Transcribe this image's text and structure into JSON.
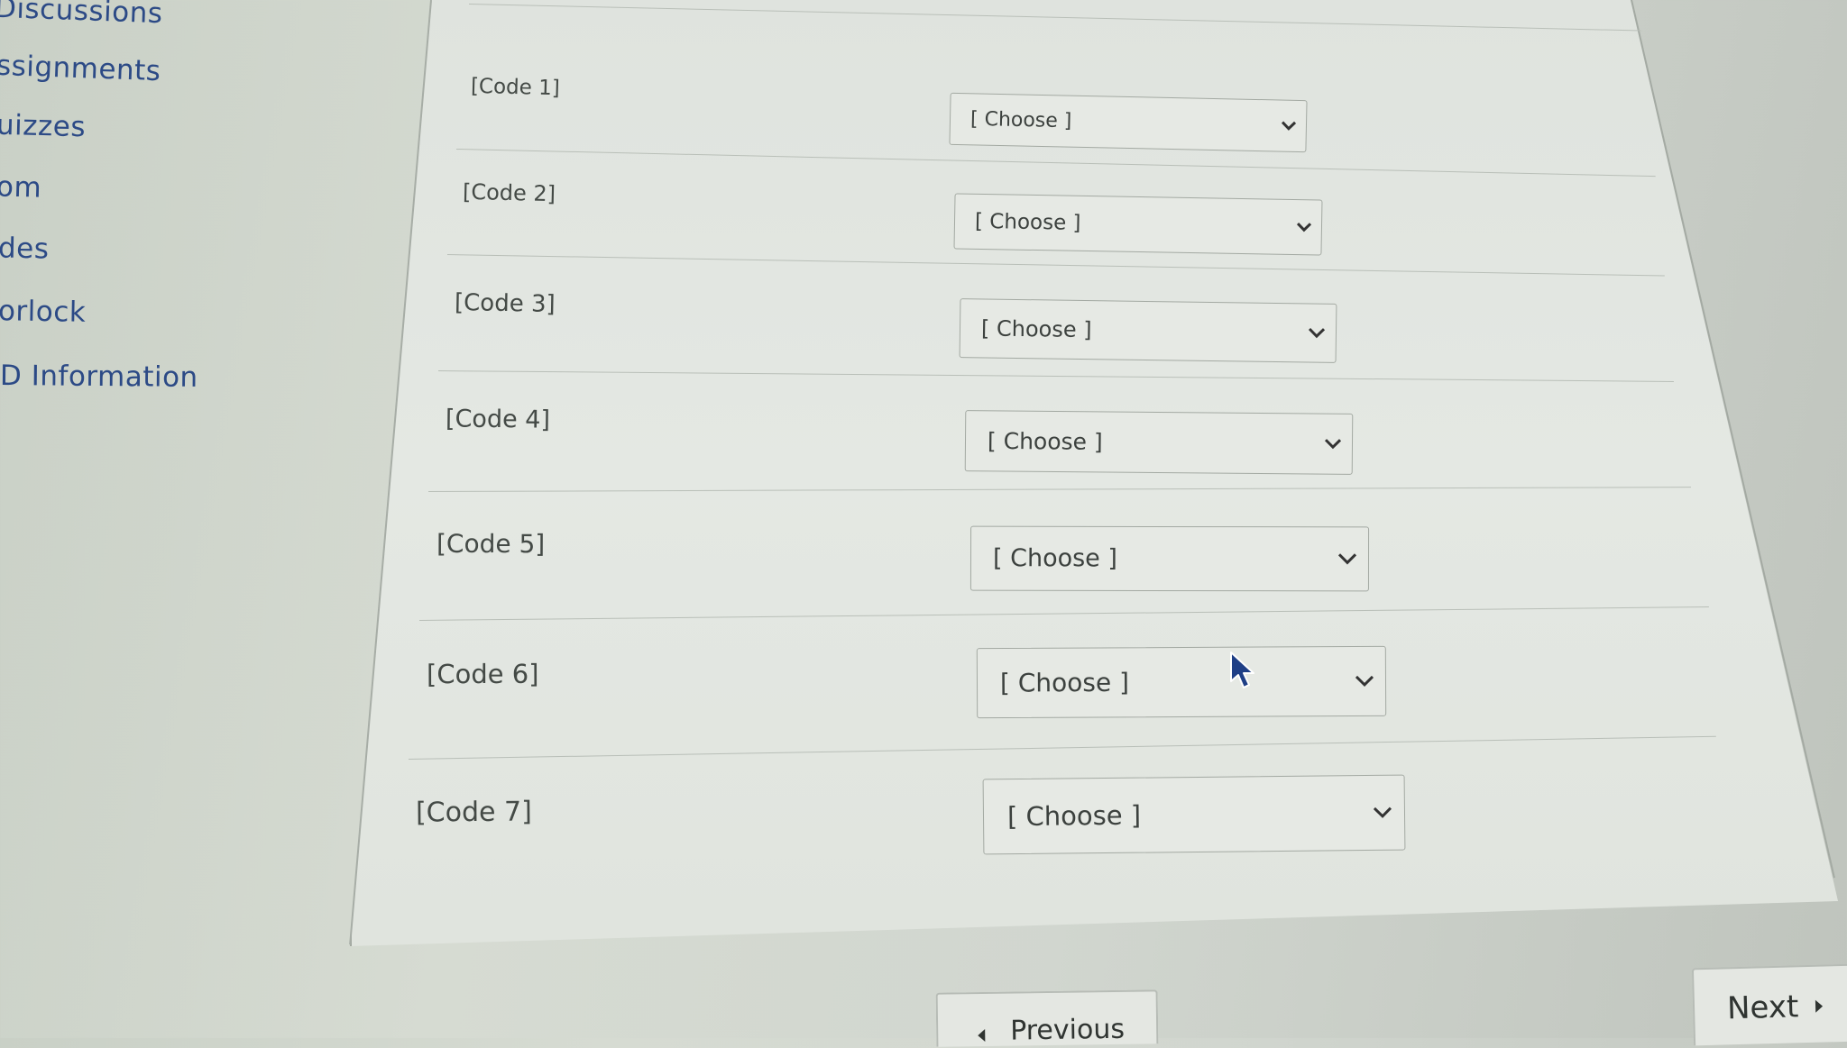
{
  "sidebar": {
    "items": [
      {
        "label": "Discussions"
      },
      {
        "label": "ssignments"
      },
      {
        "label": "uizzes"
      },
      {
        "label": "om"
      },
      {
        "label": "des"
      },
      {
        "label": "orlock"
      },
      {
        "label": "D Information"
      }
    ]
  },
  "questions": [
    {
      "label": "[Code 1]",
      "selected": "[ Choose ]"
    },
    {
      "label": "[Code 2]",
      "selected": "[ Choose ]"
    },
    {
      "label": "[Code 3]",
      "selected": "[ Choose ]"
    },
    {
      "label": "[Code 4]",
      "selected": "[ Choose ]"
    },
    {
      "label": "[Code 5]",
      "selected": "[ Choose ]"
    },
    {
      "label": "[Code 6]",
      "selected": "[ Choose ]"
    },
    {
      "label": "[Code 7]",
      "selected": "[ Choose ]"
    }
  ],
  "footer": {
    "previous_label": "Previous",
    "next_label": "Next"
  },
  "colors": {
    "nav_link": "#2c4a86",
    "cursor": "#1f3f86"
  }
}
